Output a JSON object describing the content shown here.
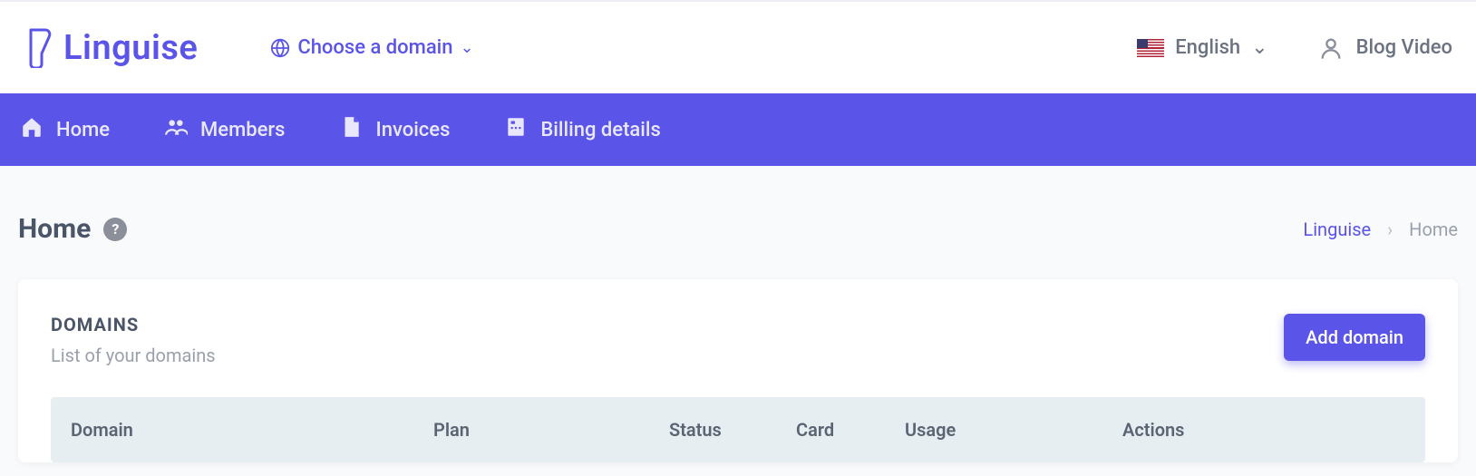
{
  "brand": {
    "name": "Linguise"
  },
  "topbar": {
    "domain_picker_label": "Choose a domain",
    "lang_label": "English",
    "user_name": "Blog Video"
  },
  "nav": {
    "home": "Home",
    "members": "Members",
    "invoices": "Invoices",
    "billing": "Billing details"
  },
  "page": {
    "title": "Home",
    "help_glyph": "?"
  },
  "breadcrumb": {
    "root": "Linguise",
    "sep": "›",
    "current": "Home"
  },
  "domains_card": {
    "title": "DOMAINS",
    "subtitle": "List of your domains",
    "add_button": "Add domain",
    "columns": {
      "domain": "Domain",
      "plan": "Plan",
      "status": "Status",
      "card": "Card",
      "usage": "Usage",
      "actions": "Actions"
    }
  }
}
